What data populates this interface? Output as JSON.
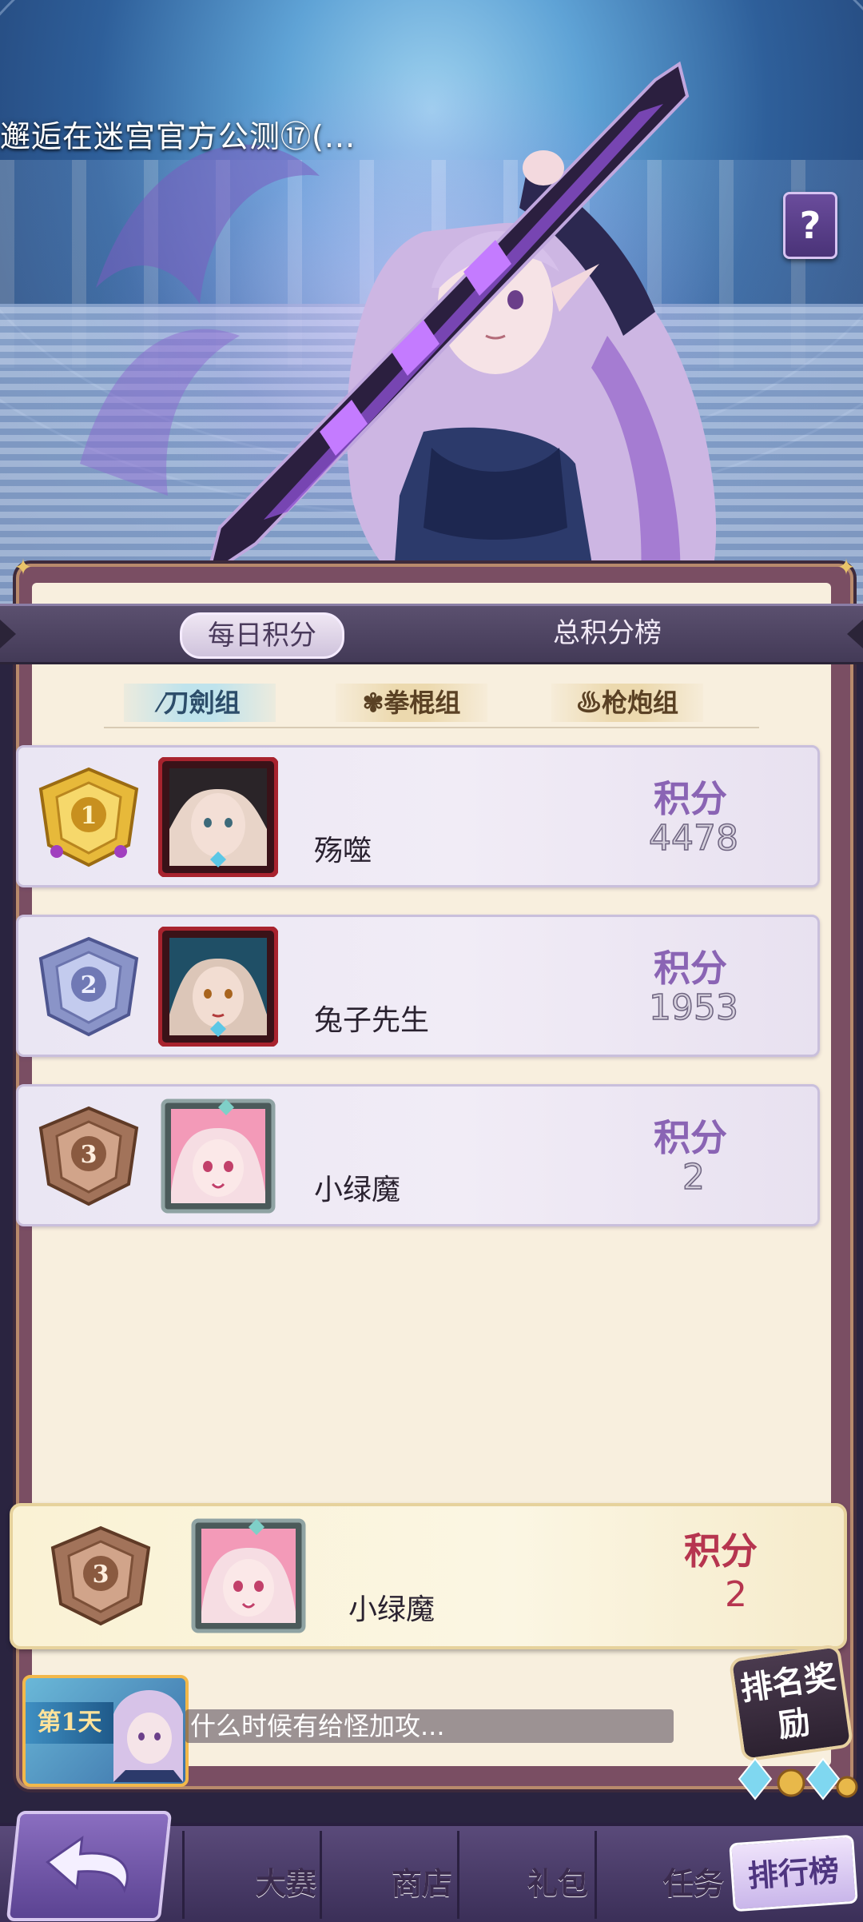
{
  "banner": {
    "event_title": "邂逅在迷宫官方公测⑰(...",
    "help_label": "?"
  },
  "tabs": {
    "daily": "每日积分",
    "total": "总积分榜"
  },
  "groups": {
    "blade": "刀劍组",
    "fist": "拳棍组",
    "gun": "枪炮组"
  },
  "ranking": [
    {
      "rank": "1",
      "name": "殇噬",
      "score_label": "积分",
      "score": "4478"
    },
    {
      "rank": "2",
      "name": "兔子先生",
      "score_label": "积分",
      "score": "1953"
    },
    {
      "rank": "3",
      "name": "小绿魔",
      "score_label": "积分",
      "score": "2"
    }
  ],
  "my_rank": {
    "rank": "3",
    "name": "小绿魔",
    "score_label": "积分",
    "score": "2"
  },
  "chat": {
    "day_badge": "第1天",
    "message": "什么时候有给怪加攻..."
  },
  "rank_reward": {
    "label": "排名奖励"
  },
  "nav": {
    "contest": "大赛",
    "shop": "商店",
    "gift": "礼包",
    "task": "任务",
    "leaderboard": "排行榜"
  },
  "colors": {
    "panel_bg": "#f8efde",
    "frame": "#7a4e63",
    "score_label_purple": "#8a64b4",
    "my_score_red": "#b6354f",
    "gold_medal": "#e7b93a",
    "silver_medal": "#8a94c8",
    "bronze_medal": "#a2735a"
  }
}
